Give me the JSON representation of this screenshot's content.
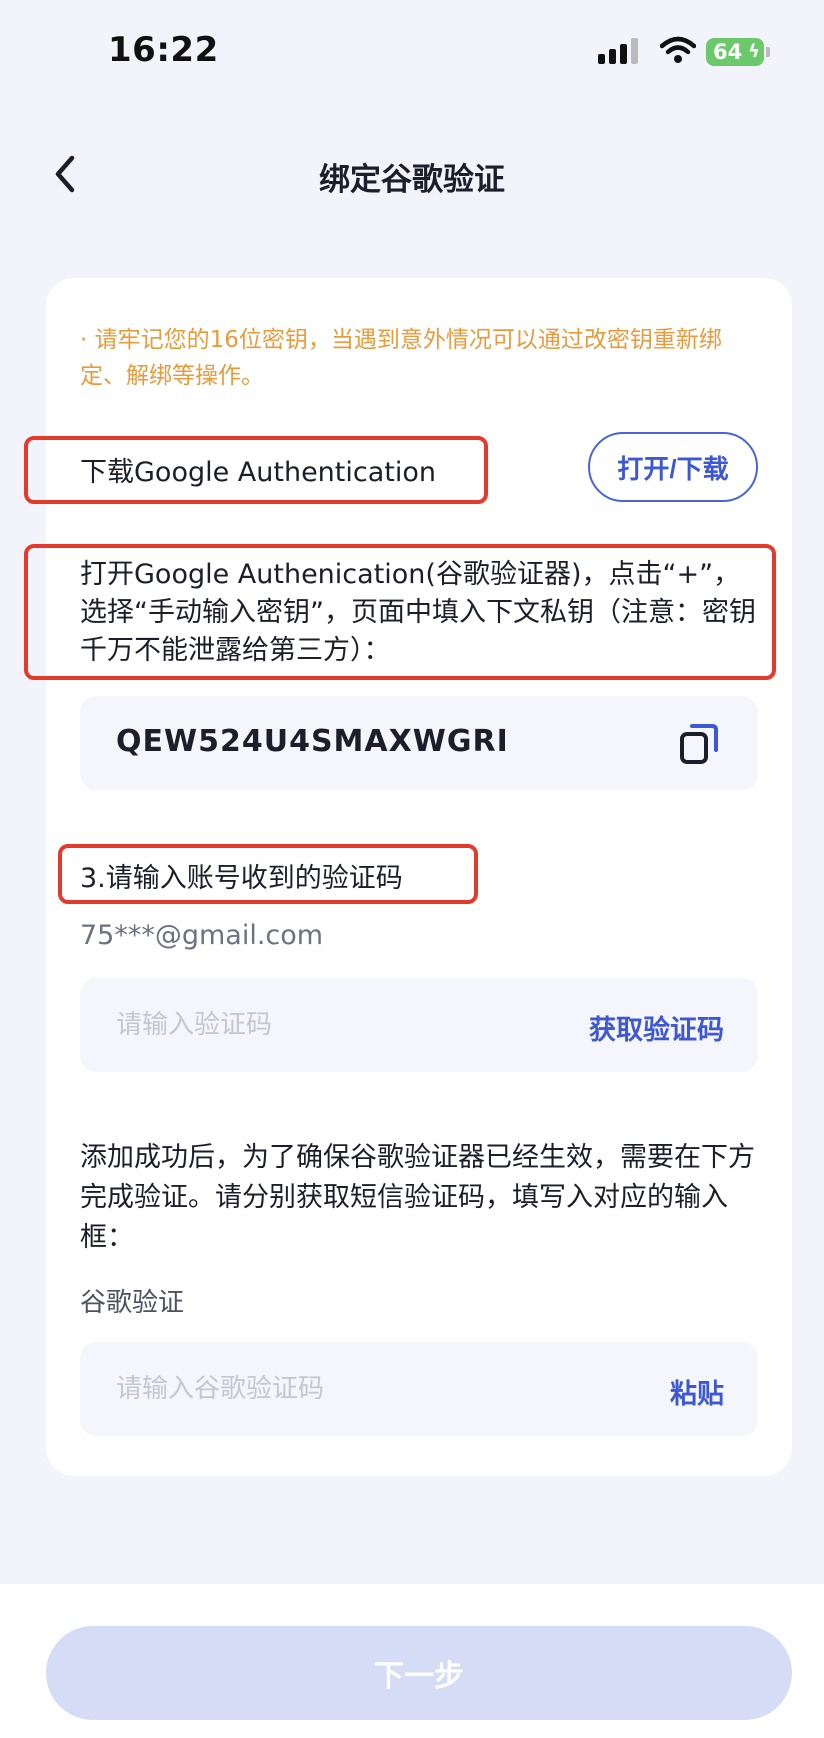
{
  "status_bar": {
    "time": "16:22",
    "battery": "64"
  },
  "header": {
    "title": "绑定谷歌验证"
  },
  "notice": "· 请牢记您的16位密钥，当遇到意外情况可以通过改密钥重新绑定、解绑等操作。",
  "download": {
    "label": "下载Google Authentication",
    "button": "打开/下载"
  },
  "instruction": "打开Google Authenication(谷歌验证器)，点击“+”，选择“手动输入密钥”，页面中填入下文私钥（注意：密钥千万不能泄露给第三方）：",
  "secret_key": "QEW524U4SMAXWGRI",
  "step3": {
    "label": "3.请输入账号收到的验证码",
    "email": "75***@gmail.com",
    "placeholder": "请输入验证码",
    "action": "获取验证码"
  },
  "success_text": "添加成功后，为了确保谷歌验证器已经生效，需要在下方完成验证。请分别获取短信验证码，填写入对应的输入框：",
  "google_verify": {
    "label": "谷歌验证",
    "placeholder": "请输入谷歌验证码",
    "action": "粘贴"
  },
  "footer": {
    "next_button": "下一步"
  },
  "colors": {
    "accent": "#3d58d2",
    "warning": "#e89b3c",
    "highlight_box": "#e5392c",
    "disabled_button": "#d4dcf6"
  }
}
